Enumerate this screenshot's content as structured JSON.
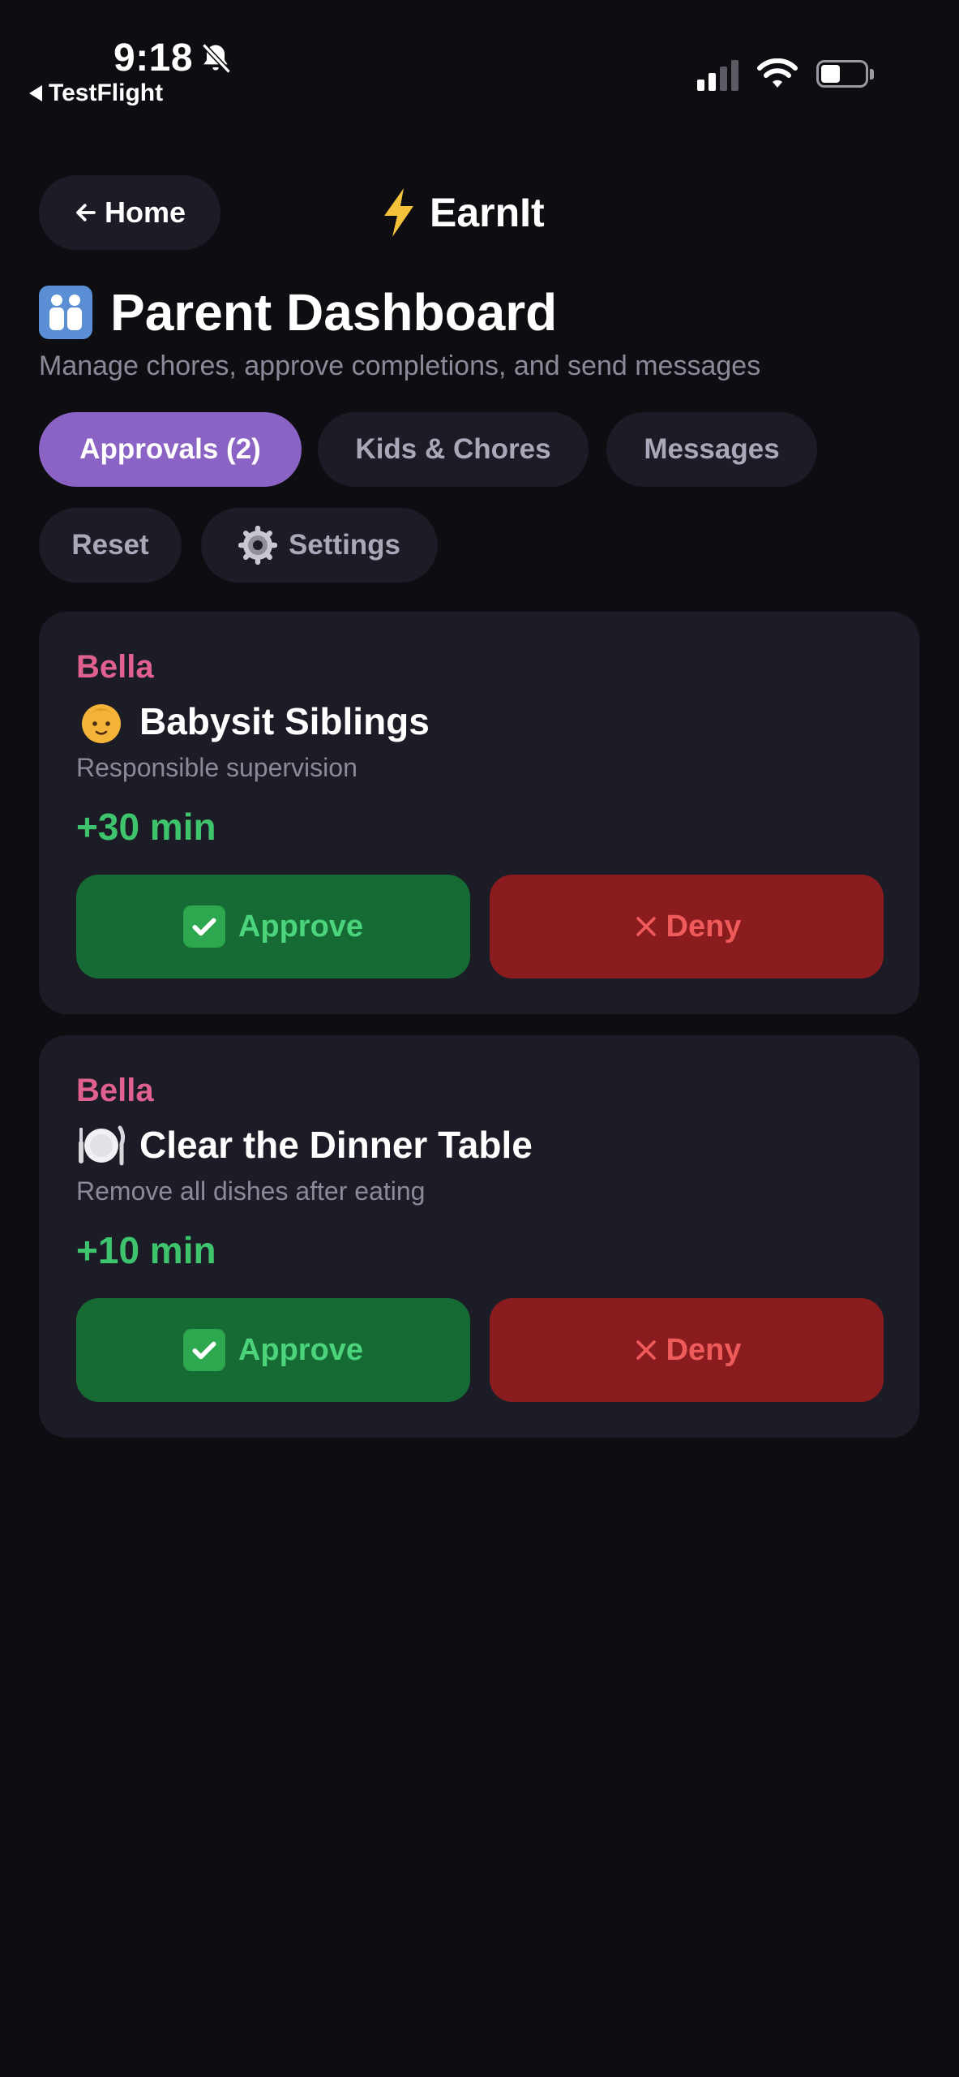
{
  "status_bar": {
    "time": "9:18",
    "back_app": "TestFlight",
    "battery_level": 0.45
  },
  "header": {
    "home_label": "Home",
    "app_name": "EarnIt"
  },
  "page": {
    "title": "Parent Dashboard",
    "subtitle": "Manage chores, approve completions, and send messages"
  },
  "tabs": [
    {
      "label": "Approvals (2)",
      "active": true
    },
    {
      "label": "Kids & Chores",
      "active": false
    },
    {
      "label": "Messages",
      "active": false
    },
    {
      "label": "Reset",
      "active": false
    },
    {
      "label": "Settings",
      "active": false
    }
  ],
  "approvals": [
    {
      "kid": "Bella",
      "chore": "Babysit Siblings",
      "icon": "baby-icon",
      "description": "Responsible supervision",
      "reward": "+30 min",
      "approve_label": "Approve",
      "deny_label": "Deny"
    },
    {
      "kid": "Bella",
      "chore": "Clear the Dinner Table",
      "icon": "plate-icon",
      "description": "Remove all dishes after eating",
      "reward": "+10 min",
      "approve_label": "Approve",
      "deny_label": "Deny"
    }
  ],
  "colors": {
    "background": "#0d0d12",
    "surface": "#1c1c26",
    "accent": "#8a63c4",
    "kid_name": "#e0608f",
    "reward": "#3ec46d",
    "approve_bg": "#166b34",
    "deny_bg": "#8a1c1f"
  }
}
